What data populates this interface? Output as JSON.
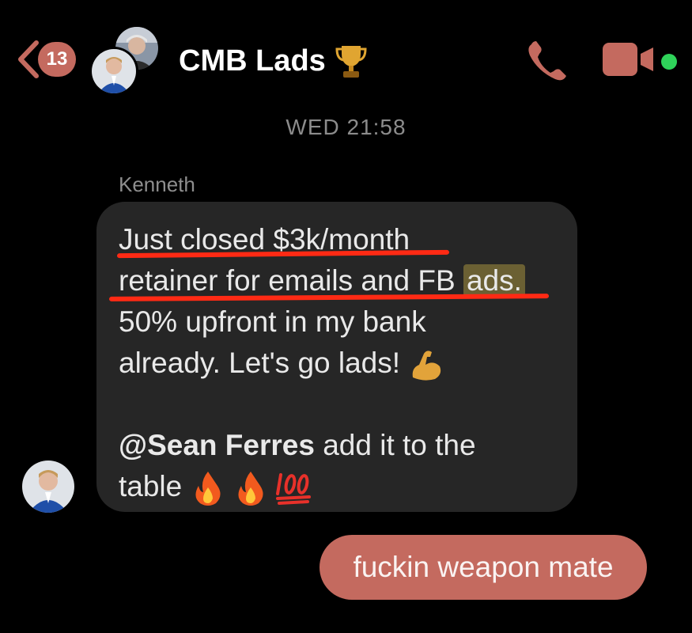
{
  "header": {
    "unread_count": "13",
    "group_name": "CMB Lads"
  },
  "thread": {
    "timestamp": "WED 21:58",
    "incoming": {
      "sender": "Kenneth",
      "lines": [
        "Just closed $3k/month",
        "retainer for emails and FB",
        "ads.",
        "50% upfront in my bank",
        "already. Let's go lads!",
        "@Sean Ferres",
        "add it to the",
        "table"
      ]
    },
    "outgoing": {
      "text": "fuckin weapon mate"
    }
  },
  "colors": {
    "accent": "#c46a5f",
    "bubble": "#262626",
    "annotation": "#ff2a14",
    "highlight": "#6b6033",
    "online": "#2fd35a"
  },
  "icons": [
    "back-chevron-icon",
    "trophy-emoji-icon",
    "phone-icon",
    "video-camera-icon",
    "flexed-biceps-emoji-icon",
    "fire-emoji-icon",
    "hundred-points-emoji-icon"
  ]
}
